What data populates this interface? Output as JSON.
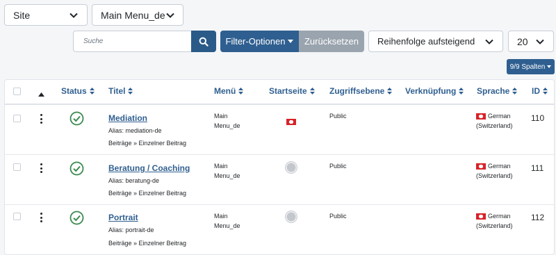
{
  "toolbar": {
    "client_select": "Site",
    "menu_select": "Main Menu_de",
    "search_placeholder": "Suche",
    "filter_label": "Filter-Optionen",
    "reset_label": "Zurücksetzen",
    "ordering_select": "Reihenfolge aufsteigend",
    "limit_select": "20",
    "columns_label": "9/9 Spalten"
  },
  "table": {
    "columns": {
      "status": "Status",
      "title": "Titel",
      "menu": "Menü",
      "home": "Startseite",
      "access": "Zugriffsebene",
      "association": "Verknüpfung",
      "language": "Sprache",
      "id": "ID"
    },
    "rows": [
      {
        "title": "Mediation",
        "alias": "Alias: mediation-de",
        "type": "Beiträge » Einzelner Beitrag",
        "menu_line1": "Main",
        "menu_line2": "Menu_de",
        "home": "flag",
        "access": "Public",
        "language_line1": "German",
        "language_line2": "(Switzerland)",
        "id": "110"
      },
      {
        "title": "Beratung / Coaching",
        "alias": "Alias: beratung-de",
        "type": "Beiträge » Einzelner Beitrag",
        "menu_line1": "Main",
        "menu_line2": "Menu_de",
        "home": "dot",
        "access": "Public",
        "language_line1": "German",
        "language_line2": "(Switzerland)",
        "id": "111"
      },
      {
        "title": "Portrait",
        "alias": "Alias: portrait-de",
        "type": "Beiträge » Einzelner Beitrag",
        "menu_line1": "Main",
        "menu_line2": "Menu_de",
        "home": "dot",
        "access": "Public",
        "language_line1": "German",
        "language_line2": "(Switzerland)",
        "id": "112"
      }
    ]
  },
  "colors": {
    "accent": "#2f5f90",
    "published": "#3a8a4e",
    "flag": "#d8232a"
  }
}
